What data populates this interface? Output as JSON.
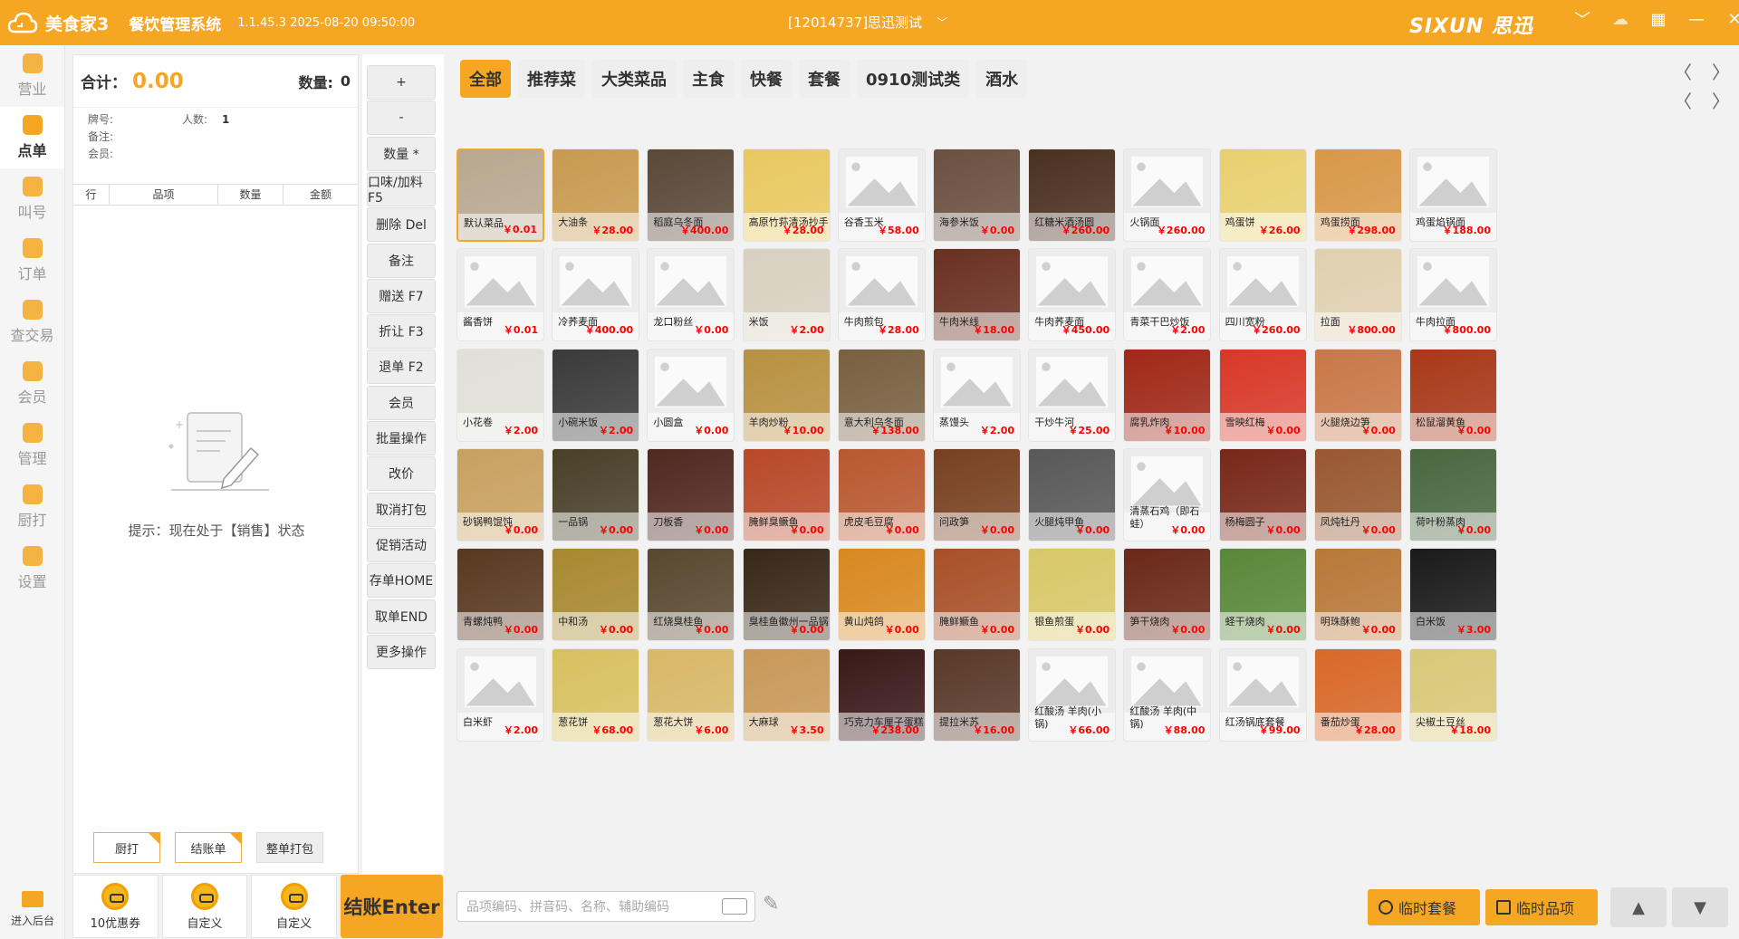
{
  "header": {
    "app_name": "美食家3",
    "system": "餐饮管理系统",
    "version": "1.1.45.3 2025-08-20 09:50:00",
    "store": "[12014737]思迅测试",
    "brand": "SIXUN 思迅"
  },
  "nav": {
    "items": [
      {
        "label": "营业",
        "active": false
      },
      {
        "label": "点单",
        "active": true
      },
      {
        "label": "叫号",
        "active": false
      },
      {
        "label": "订单",
        "active": false
      },
      {
        "label": "查交易",
        "active": false
      },
      {
        "label": "会员",
        "active": false
      },
      {
        "label": "管理",
        "active": false
      },
      {
        "label": "厨打",
        "active": false
      },
      {
        "label": "设置",
        "active": false
      }
    ],
    "bottom": "进入后台"
  },
  "order": {
    "total_label": "合计：",
    "total_value": "0.00",
    "qty_label": "数量:",
    "qty_value": "0",
    "card_label": "牌号:",
    "people_label": "人数:",
    "people_value": "1",
    "note_label": "备注:",
    "member_label": "会员:",
    "columns": [
      "行",
      "品项",
      "数量",
      "金额"
    ],
    "hint": "提示：现在处于【销售】状态",
    "btn_kitchen": "厨打",
    "btn_bill": "结账单",
    "btn_pack": "整单打包"
  },
  "functions": [
    "+",
    "-",
    "数量 *",
    "口味/加料 F5",
    "删除 Del",
    "备注",
    "赠送 F7",
    "折让 F3",
    "退单 F2",
    "会员",
    "批量操作",
    "改价",
    "取消打包",
    "促销活动",
    "存单HOME",
    "取单END",
    "更多操作"
  ],
  "bottom_left": [
    {
      "label": "10优惠券"
    },
    {
      "label": "自定义"
    },
    {
      "label": "自定义"
    }
  ],
  "checkout": "结账Enter",
  "categories": [
    {
      "label": "全部",
      "active": true
    },
    {
      "label": "推荐菜",
      "active": false
    },
    {
      "label": "大类菜品",
      "active": false
    },
    {
      "label": "主食",
      "active": false
    },
    {
      "label": "快餐",
      "active": false
    },
    {
      "label": "套餐",
      "active": false
    },
    {
      "label": "0910测试类",
      "active": false
    },
    {
      "label": "酒水",
      "active": false
    }
  ],
  "dishes": [
    {
      "name": "默认菜品",
      "price": "￥0.01",
      "color": "#b8a890"
    },
    {
      "name": "大油条",
      "price": "￥28.00",
      "color": "#c89a50"
    },
    {
      "name": "稻庭乌冬面",
      "price": "￥400.00",
      "color": "#5a4838"
    },
    {
      "name": "高原竹荪清汤抄手",
      "price": "￥28.00",
      "color": "#e8c860"
    },
    {
      "name": "谷香玉米",
      "price": "￥58.00",
      "color": ""
    },
    {
      "name": "海参米饭",
      "price": "￥0.00",
      "color": "#6a5040"
    },
    {
      "name": "红糖米酒汤圆",
      "price": "￥260.00",
      "color": "#4a3020"
    },
    {
      "name": "火锅面",
      "price": "￥260.00",
      "color": ""
    },
    {
      "name": "鸡蛋饼",
      "price": "￥26.00",
      "color": "#e8d070"
    },
    {
      "name": "鸡蛋捞面",
      "price": "￥298.00",
      "color": "#d89848"
    },
    {
      "name": "鸡蛋焰锅面",
      "price": "￥188.00",
      "color": ""
    },
    {
      "name": "酱香饼",
      "price": "￥0.01",
      "color": ""
    },
    {
      "name": "冷荞麦面",
      "price": "￥400.00",
      "color": ""
    },
    {
      "name": "龙口粉丝",
      "price": "￥0.00",
      "color": ""
    },
    {
      "name": "米饭",
      "price": "￥2.00",
      "color": "#d8d0c0"
    },
    {
      "name": "牛肉煎包",
      "price": "￥28.00",
      "color": ""
    },
    {
      "name": "牛肉米线",
      "price": "￥18.00",
      "color": "#6a3020"
    },
    {
      "name": "牛肉荞麦面",
      "price": "￥450.00",
      "color": ""
    },
    {
      "name": "青菜干巴炒饭",
      "price": "￥2.00",
      "color": ""
    },
    {
      "name": "四川宽粉",
      "price": "￥260.00",
      "color": ""
    },
    {
      "name": "拉面",
      "price": "￥800.00",
      "color": "#e0d0b0"
    },
    {
      "name": "牛肉拉面",
      "price": "￥800.00",
      "color": ""
    },
    {
      "name": "小花卷",
      "price": "￥2.00",
      "color": "#e0e0d8"
    },
    {
      "name": "小碗米饭",
      "price": "￥2.00",
      "color": "#3a3a3a"
    },
    {
      "name": "小圆盒",
      "price": "￥0.00",
      "color": ""
    },
    {
      "name": "羊肉炒粉",
      "price": "￥10.00",
      "color": "#b89040"
    },
    {
      "name": "意大利乌冬面",
      "price": "￥138.00",
      "color": "#786040"
    },
    {
      "name": "蒸馒头",
      "price": "￥2.00",
      "color": ""
    },
    {
      "name": "干炒牛河",
      "price": "￥25.00",
      "color": ""
    },
    {
      "name": "腐乳炸肉",
      "price": "￥10.00",
      "color": "#a02818"
    },
    {
      "name": "雪映红梅",
      "price": "￥0.00",
      "color": "#d83828"
    },
    {
      "name": "火腿烧边笋",
      "price": "￥0.00",
      "color": "#c87848"
    },
    {
      "name": "松鼠溜黄鱼",
      "price": "￥0.00",
      "color": "#a83818"
    },
    {
      "name": "砂锅鸭馄饨",
      "price": "￥0.00",
      "color": "#c8a060"
    },
    {
      "name": "一品锅",
      "price": "￥0.00",
      "color": "#484028"
    },
    {
      "name": "刀板香",
      "price": "￥0.00",
      "color": "#502820"
    },
    {
      "name": "腌鲜臭鳜鱼",
      "price": "￥0.00",
      "color": "#b84828"
    },
    {
      "name": "虎皮毛豆腐",
      "price": "￥0.00",
      "color": "#b85830"
    },
    {
      "name": "问政笋",
      "price": "￥0.00",
      "color": "#784020"
    },
    {
      "name": "火腿炖甲鱼",
      "price": "￥0.00",
      "color": "#585858"
    },
    {
      "name": "清蒸石鸡（即石蛙）",
      "price": "￥0.00",
      "color": ""
    },
    {
      "name": "杨梅圆子",
      "price": "￥0.00",
      "color": "#782818"
    },
    {
      "name": "凤炖牡丹",
      "price": "￥0.00",
      "color": "#985830"
    },
    {
      "name": "荷叶粉蒸肉",
      "price": "￥0.00",
      "color": "#486840"
    },
    {
      "name": "青螺炖鸭",
      "price": "￥0.00",
      "color": "#5a3820"
    },
    {
      "name": "中和汤",
      "price": "￥0.00",
      "color": "#a88830"
    },
    {
      "name": "红烧臭桂鱼",
      "price": "￥0.00",
      "color": "#584830"
    },
    {
      "name": "臭桂鱼徽州一品锅",
      "price": "￥0.00",
      "color": "#382818"
    },
    {
      "name": "黄山炖鸽",
      "price": "￥0.00",
      "color": "#d88820"
    },
    {
      "name": "腌鲜鳜鱼",
      "price": "￥0.00",
      "color": "#a85028"
    },
    {
      "name": "银鱼煎蛋",
      "price": "￥0.00",
      "color": "#d8c868"
    },
    {
      "name": "笋干烧肉",
      "price": "￥0.00",
      "color": "#6a2818"
    },
    {
      "name": "蛏干烧肉",
      "price": "￥0.00",
      "color": "#588838"
    },
    {
      "name": "明珠酥鲍",
      "price": "￥0.00",
      "color": "#b87838"
    },
    {
      "name": "白米饭",
      "price": "￥3.00",
      "color": "#1a1a1a"
    },
    {
      "name": "白米虾",
      "price": "￥2.00",
      "color": ""
    },
    {
      "name": "葱花饼",
      "price": "￥68.00",
      "color": "#d8c060"
    },
    {
      "name": "葱花大饼",
      "price": "￥6.00",
      "color": "#d8b868"
    },
    {
      "name": "大麻球",
      "price": "￥3.50",
      "color": "#c89858"
    },
    {
      "name": "巧克力车厘子蛋糕",
      "price": "￥238.00",
      "color": "#3a1818"
    },
    {
      "name": "提拉米苏",
      "price": "￥16.00",
      "color": "#5a3828"
    },
    {
      "name": "红酸汤 羊肉(小锅)",
      "price": "￥66.00",
      "color": ""
    },
    {
      "name": "红酸汤 羊肉(中锅)",
      "price": "￥88.00",
      "color": ""
    },
    {
      "name": "红汤锅底套餐",
      "price": "￥99.00",
      "color": ""
    },
    {
      "name": "番茄炒蛋",
      "price": "￥28.00",
      "color": "#d86828"
    },
    {
      "name": "尖椒土豆丝",
      "price": "￥18.00",
      "color": "#d8c878"
    }
  ],
  "search_placeholder": "品项编码、拼音码、名称、辅助编码",
  "btn_temp_set": "临时套餐",
  "btn_temp_item": "临时品项",
  "icons": {
    "up": "▲",
    "down": "▼",
    "left": "〈",
    "right": "〉"
  }
}
